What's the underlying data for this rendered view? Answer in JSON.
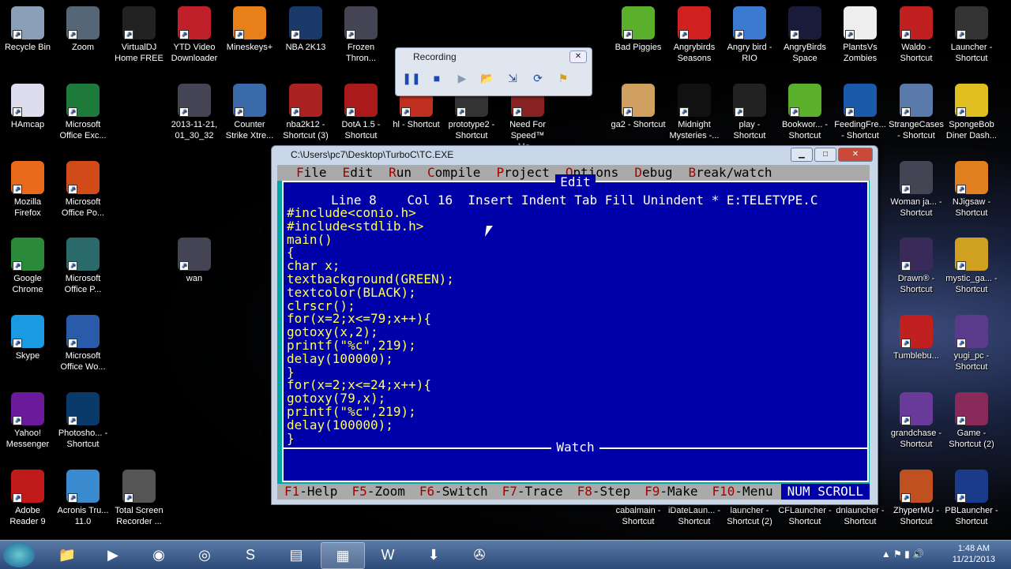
{
  "desktop_icons_left": [
    {
      "label": "Recycle Bin",
      "icon": "recycle-bin-icon",
      "color": "#8aa0b8"
    },
    {
      "label": "Zoom",
      "icon": "binoculars-icon",
      "color": "#556677"
    },
    {
      "label": "VirtualDJ Home FREE",
      "icon": "virtualdj-icon",
      "color": "#222"
    },
    {
      "label": "YTD Video Downloader",
      "icon": "ytd-icon",
      "color": "#c0202a"
    },
    {
      "label": "Mineskeys+",
      "icon": "mineskeys-icon",
      "color": "#e8801a"
    },
    {
      "label": "NBA 2K13",
      "icon": "nba-icon",
      "color": "#1a3a6a"
    },
    {
      "label": "Frozen Thron...",
      "icon": "frozen-throne-icon",
      "color": "#445"
    },
    {
      "label": "HAmcap",
      "icon": "hamcap-icon",
      "color": "#dde"
    },
    {
      "label": "Microsoft Office Exc...",
      "icon": "excel-icon",
      "color": "#1e7a3a"
    },
    {
      "label": "2013-11-21, 01_30_32",
      "icon": "video-file-icon",
      "color": "#445"
    },
    {
      "label": "Counter Strike Xtre...",
      "icon": "counter-strike-icon",
      "color": "#3a6aaa"
    },
    {
      "label": "nba2k12 - Shortcut (3)",
      "icon": "nba2k12-icon",
      "color": "#aa2222"
    },
    {
      "label": "DotA 1.5 - Shortcut",
      "icon": "dota-icon",
      "color": "#aa1a1a"
    },
    {
      "label": "hl - Shortcut",
      "icon": "hl-icon",
      "color": "#c03020"
    },
    {
      "label": "prototype2 - Shortcut",
      "icon": "prototype2-icon",
      "color": "#333"
    },
    {
      "label": "Need For Speed™ Mo...",
      "icon": "nfs-icon",
      "color": "#882222"
    },
    {
      "label": "Mozilla Firefox",
      "icon": "firefox-icon",
      "color": "#e86a1a"
    },
    {
      "label": "Microsoft Office Po...",
      "icon": "powerpoint-icon",
      "color": "#d04a1a"
    },
    {
      "label": "Google Chrome",
      "icon": "chrome-icon",
      "color": "#2a8a3a"
    },
    {
      "label": "Microsoft Office P...",
      "icon": "publisher-icon",
      "color": "#2a6a6a"
    },
    {
      "label": "wan",
      "icon": "video-file-icon",
      "color": "#445"
    },
    {
      "label": "Skype",
      "icon": "skype-icon",
      "color": "#1a9ae0"
    },
    {
      "label": "Microsoft Office Wo...",
      "icon": "word-icon",
      "color": "#2a5aaa"
    },
    {
      "label": "Yahoo! Messenger",
      "icon": "yahoo-icon",
      "color": "#6a1a9a"
    },
    {
      "label": "Photosho... - Shortcut",
      "icon": "photoshop-icon",
      "color": "#0a3a6a"
    },
    {
      "label": "Adobe Reader 9",
      "icon": "adobe-reader-icon",
      "color": "#c01a1a"
    },
    {
      "label": "Acronis Tru... 11.0",
      "icon": "acronis-icon",
      "color": "#3a8ad0"
    },
    {
      "label": "Total Screen Recorder ...",
      "icon": "film-reel-icon",
      "color": "#555"
    }
  ],
  "desktop_icons_right": [
    {
      "label": "Bad Piggies",
      "icon": "bad-piggies-icon",
      "color": "#5ab02a"
    },
    {
      "label": "Angrybirds Seasons",
      "icon": "angrybirds-icon",
      "color": "#d02020"
    },
    {
      "label": "Angry bird - RIO",
      "icon": "angrybirds-rio-icon",
      "color": "#3a7ad0"
    },
    {
      "label": "AngryBirds Space",
      "icon": "angrybirds-space-icon",
      "color": "#1a1a3a"
    },
    {
      "label": "PlantsVs Zombies",
      "icon": "pvz-icon",
      "color": "#eee"
    },
    {
      "label": "Waldo - Shortcut",
      "icon": "waldo-icon",
      "color": "#c02020"
    },
    {
      "label": "Launcher - Shortcut",
      "icon": "launcher-icon",
      "color": "#333"
    },
    {
      "label": "ga2 - Shortcut",
      "icon": "ga2-icon",
      "color": "#d0a060"
    },
    {
      "label": "Midnight Mysteries -...",
      "icon": "midnight-icon",
      "color": "#111"
    },
    {
      "label": "play - Shortcut",
      "icon": "play-icon",
      "color": "#222"
    },
    {
      "label": "Bookwor... - Shortcut",
      "icon": "bookworm-icon",
      "color": "#5ab02a"
    },
    {
      "label": "FeedingFre... - Shortcut",
      "icon": "feeding-frenzy-icon",
      "color": "#1a5aaa"
    },
    {
      "label": "StrangeCases - Shortcut",
      "icon": "strangecases-icon",
      "color": "#5a7aaa"
    },
    {
      "label": "SpongeBob Diner Dash...",
      "icon": "spongebob-icon",
      "color": "#e0c020"
    },
    {
      "label": "Woman ja... - Shortcut",
      "icon": "woman-icon",
      "color": "#445"
    },
    {
      "label": "NJigsaw - Shortcut",
      "icon": "jigsaw-icon",
      "color": "#e08020"
    },
    {
      "label": "Drawn® - Shortcut",
      "icon": "drawn-icon",
      "color": "#3a2a5a"
    },
    {
      "label": "mystic_ga... - Shortcut",
      "icon": "mystic-icon",
      "color": "#d0a020"
    },
    {
      "label": "Tumblebu...",
      "icon": "tumblebugs-icon",
      "color": "#c02020"
    },
    {
      "label": "yugi_pc - Shortcut",
      "icon": "yugi-icon",
      "color": "#5a3a8a"
    },
    {
      "label": "grandchase - Shortcut",
      "icon": "grandchase-icon",
      "color": "#6a3a9a"
    },
    {
      "label": "Game - Shortcut (2)",
      "icon": "game-icon",
      "color": "#8a2a5a"
    },
    {
      "label": "cabalmain - Shortcut",
      "icon": "cabal-icon",
      "color": "#000"
    },
    {
      "label": "iDateLaun... - Shortcut",
      "icon": "idate-icon",
      "color": "#000"
    },
    {
      "label": "launcher - Shortcut (2)",
      "icon": "launcher-icon",
      "color": "#000"
    },
    {
      "label": "CFLauncher - Shortcut",
      "icon": "cf-icon",
      "color": "#000"
    },
    {
      "label": "dnlauncher - Shortcut",
      "icon": "dn-icon",
      "color": "#000"
    },
    {
      "label": "ZhyperMU - Shortcut",
      "icon": "zhypermu-icon",
      "color": "#c05020"
    },
    {
      "label": "PBLauncher - Shortcut",
      "icon": "pb-icon",
      "color": "#1a3a8a"
    }
  ],
  "recording": {
    "title": "Recording"
  },
  "window": {
    "title": "C:\\Users\\pc7\\Desktop\\TurboC\\TC.EXE"
  },
  "menu": [
    {
      "hk": "F",
      "rest": "ile"
    },
    {
      "hk": "E",
      "rest": "dit"
    },
    {
      "hk": "R",
      "rest": "un"
    },
    {
      "hk": "C",
      "rest": "ompile"
    },
    {
      "hk": "P",
      "rest": "roject"
    },
    {
      "hk": "O",
      "rest": "ptions"
    },
    {
      "hk": "D",
      "rest": "ebug"
    },
    {
      "hk": "B",
      "rest": "reak/watch"
    }
  ],
  "editor": {
    "title": "Edit",
    "status": "Line 8    Col 16  Insert Indent Tab Fill Unindent * E:TELETYPE.C",
    "code": [
      "#include<conio.h>",
      "#include<stdlib.h>",
      "main()",
      "{",
      "char x;",
      "textbackground(GREEN);",
      "textcolor(BLACK);",
      "clrscr();",
      "for(x=2;x<=79;x++){",
      "gotoxy(x,2);",
      "printf(\"%c\",219);",
      "delay(100000);",
      "}",
      "for(x=2;x<=24;x++){",
      "gotoxy(79,x);",
      "printf(\"%c\",219);",
      "delay(100000);",
      "}"
    ],
    "watch": "Watch"
  },
  "fkeys": [
    {
      "hk": "F1",
      "rest": "-Help"
    },
    {
      "hk": "F5",
      "rest": "-Zoom"
    },
    {
      "hk": "F6",
      "rest": "-Switch"
    },
    {
      "hk": "F7",
      "rest": "-Trace"
    },
    {
      "hk": "F8",
      "rest": "-Step"
    },
    {
      "hk": "F9",
      "rest": "-Make"
    },
    {
      "hk": "F10",
      "rest": "-Menu"
    }
  ],
  "fkeys_status": "NUM SCROLL",
  "clock": {
    "time": "1:48 AM",
    "date": "11/21/2013"
  }
}
